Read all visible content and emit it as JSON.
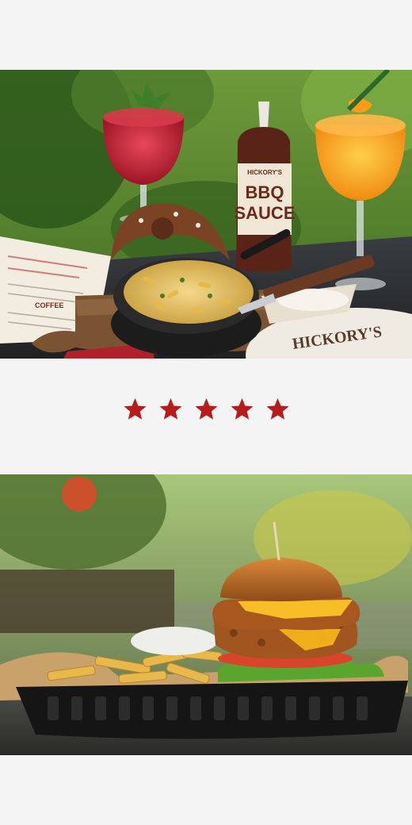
{
  "top_photo": {
    "bottle_brand": "HICKORY'S",
    "bottle_label_line1": "BBQ",
    "bottle_label_line2": "SAUCE",
    "menu_text": "COFFEE",
    "plate_text": "HICKORY'S"
  },
  "rating": {
    "value": 5,
    "max": 5,
    "icon": "star-icon",
    "color": "#b71c1c"
  },
  "bottom_photo": {}
}
